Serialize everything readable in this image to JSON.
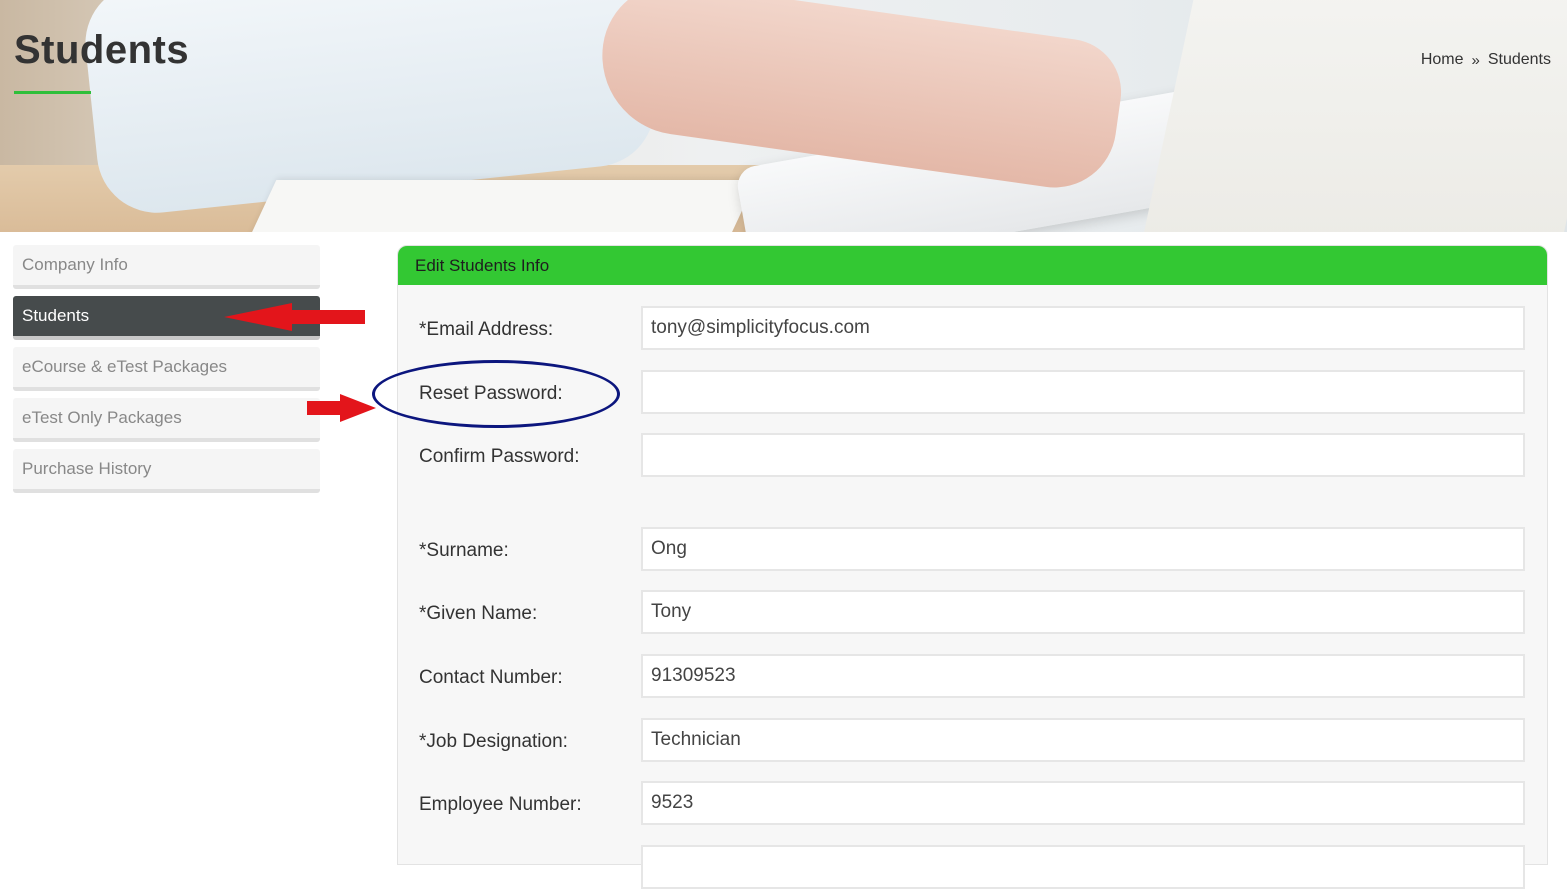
{
  "header": {
    "title": "Students",
    "breadcrumb": {
      "home": "Home",
      "separator": "»",
      "current": "Students"
    }
  },
  "sidebar": {
    "items": [
      {
        "label": "Company Info",
        "active": false
      },
      {
        "label": "Students",
        "active": true
      },
      {
        "label": "eCourse & eTest Packages",
        "active": false
      },
      {
        "label": "eTest Only Packages",
        "active": false
      },
      {
        "label": "Purchase History",
        "active": false
      }
    ]
  },
  "panel": {
    "title": "Edit Students Info",
    "fields": {
      "email": {
        "label": "*Email Address:",
        "value": "tony@simplicityfocus.com"
      },
      "reset_password": {
        "label": "Reset Password:",
        "value": ""
      },
      "confirm_password": {
        "label": "Confirm Password:",
        "value": ""
      },
      "surname": {
        "label": "*Surname:",
        "value": "Ong"
      },
      "given_name": {
        "label": "*Given Name:",
        "value": "Tony"
      },
      "contact_number": {
        "label": "Contact Number:",
        "value": "91309523"
      },
      "job_designation": {
        "label": "*Job Designation:",
        "value": "Technician"
      },
      "employee_number": {
        "label": "Employee Number:",
        "value": "9523"
      }
    }
  },
  "colors": {
    "accent_green": "#33c833",
    "active_sidebar": "#464b4c",
    "annotation_arrow": "#e3151b",
    "annotation_ellipse": "#0c167e"
  }
}
